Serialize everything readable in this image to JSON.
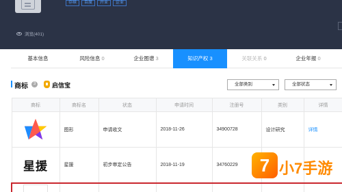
{
  "header": {
    "tags": [
      "存续",
      "百度",
      "开业",
      "企业"
    ],
    "views_label": "浏览(401)"
  },
  "tabs": [
    {
      "label": "基本信息",
      "count": ""
    },
    {
      "label": "风险信息",
      "count": "0"
    },
    {
      "label": "企业图谱",
      "count": "3"
    },
    {
      "label": "知识产权",
      "count": "3"
    },
    {
      "label": "关联关系",
      "count": "0"
    },
    {
      "label": "企业年报",
      "count": "0"
    }
  ],
  "section": {
    "title": "商标",
    "count": "3",
    "provider": "启信宝"
  },
  "filters": {
    "category": "全部类别",
    "status": "全部状态"
  },
  "table": {
    "headers": [
      "商标",
      "商标名",
      "状态",
      "申请时间",
      "注册号",
      "类别",
      "详情"
    ],
    "rows": [
      {
        "name": "图形",
        "status": "申请收文",
        "date": "2018-11-26",
        "reg_no": "34900728",
        "category": "设计研究",
        "detail": "详情"
      },
      {
        "image_text": "星援",
        "name": "星援",
        "status": "初步审定公告",
        "date": "2018-11-19",
        "reg_no": "34760229",
        "category": "",
        "detail": ""
      }
    ]
  },
  "watermark": {
    "logo_char": "7",
    "text": "小7手游"
  },
  "colors": {
    "header_bg": "#2b3346",
    "accent": "#1890ff",
    "highlight_border": "#c9252c",
    "watermark": "#ff8a00"
  }
}
